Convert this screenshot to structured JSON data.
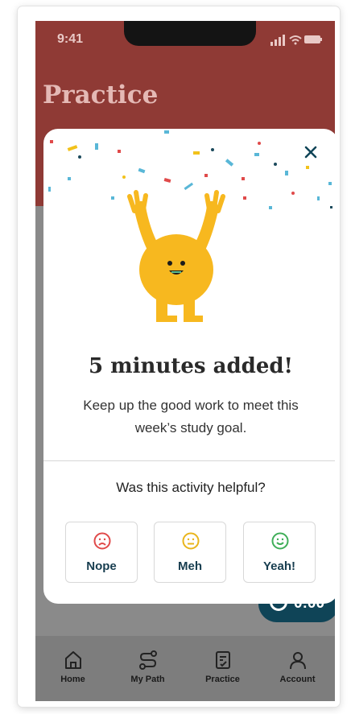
{
  "status_bar": {
    "time": "9:41"
  },
  "header": {
    "title": "Practice"
  },
  "timer": {
    "text": "0:00"
  },
  "modal": {
    "title": "5 minutes added!",
    "message": "Keep up the good work to meet this week’s study goal.",
    "feedback_question": "Was this activity helpful?",
    "feedback_options": [
      {
        "label": "Nope",
        "face": "sad-face-icon",
        "color": "#e04a4a"
      },
      {
        "label": "Meh",
        "face": "neutral-face-icon",
        "color": "#e9b51c"
      },
      {
        "label": "Yeah!",
        "face": "happy-face-icon",
        "color": "#3fae58"
      }
    ]
  },
  "tabs": [
    {
      "label": "Home",
      "icon": "home-icon"
    },
    {
      "label": "My Path",
      "icon": "path-icon"
    },
    {
      "label": "Practice",
      "icon": "practice-icon",
      "active": true
    },
    {
      "label": "Account",
      "icon": "account-icon"
    }
  ],
  "colors": {
    "header": "#8f3a35",
    "accent": "#0f4457",
    "mascot": "#f7b81f"
  }
}
